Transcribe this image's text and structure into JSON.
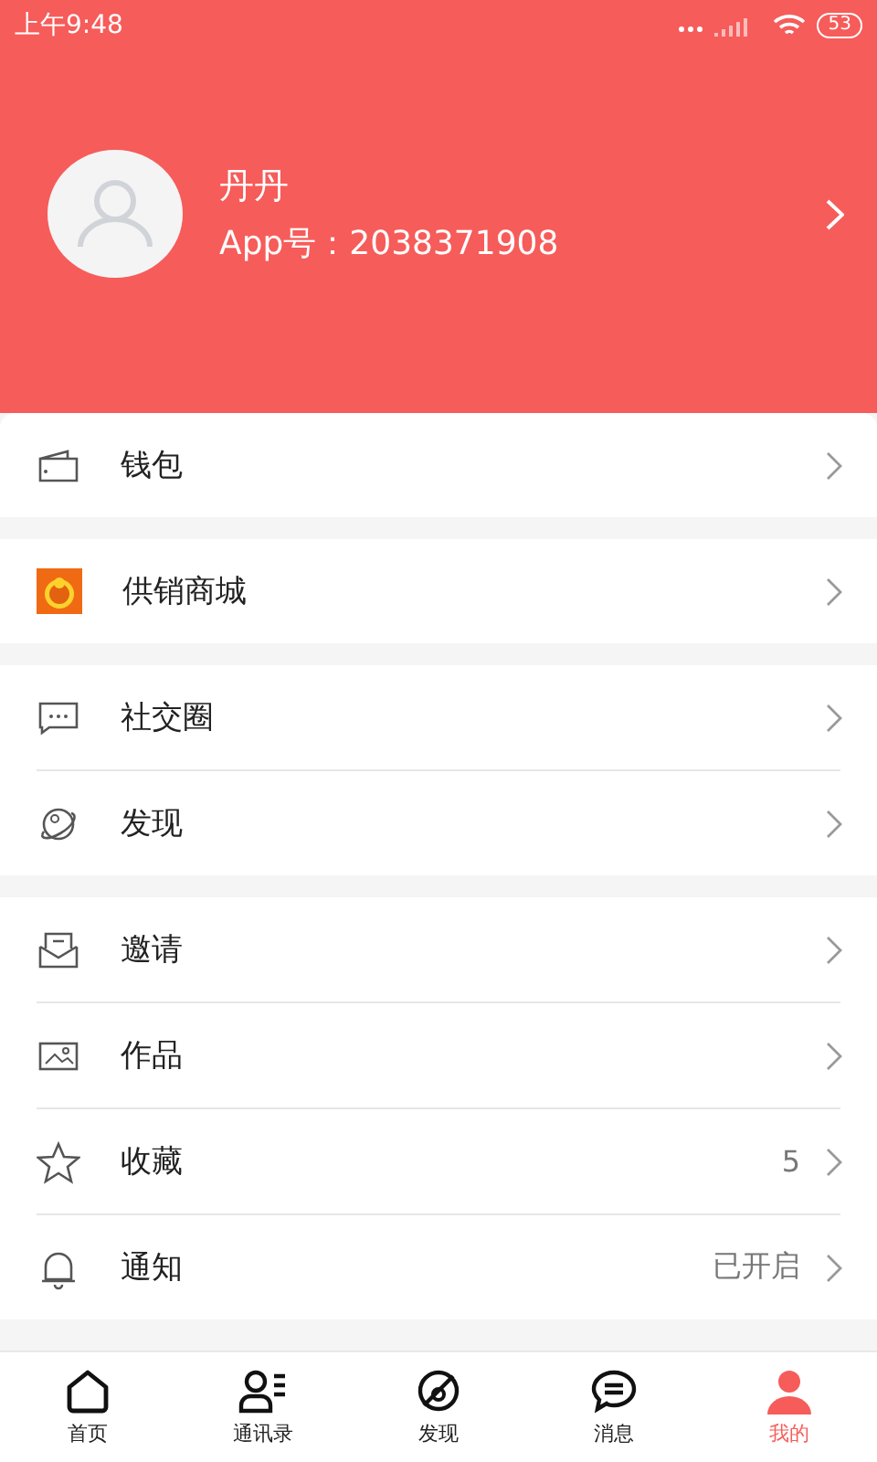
{
  "status_bar": {
    "time": "上午9:48",
    "battery": "53"
  },
  "profile": {
    "name": "丹丹",
    "app_id": "App号：2038371908"
  },
  "groups": [
    {
      "items": [
        {
          "kind": "wallet",
          "label": "钱包"
        }
      ]
    },
    {
      "items": [
        {
          "kind": "shop",
          "label": "供销商城"
        }
      ]
    },
    {
      "items": [
        {
          "kind": "chat",
          "label": "社交圈"
        },
        {
          "kind": "planet",
          "label": "发现"
        }
      ]
    },
    {
      "items": [
        {
          "kind": "mail",
          "label": "邀请"
        },
        {
          "kind": "image",
          "label": "作品"
        },
        {
          "kind": "star",
          "label": "收藏",
          "value": "5"
        },
        {
          "kind": "bell",
          "label": "通知",
          "value": "已开启"
        }
      ]
    }
  ],
  "tabs": [
    {
      "kind": "home",
      "label": "首页",
      "selected": false
    },
    {
      "kind": "contacts",
      "label": "通讯录",
      "selected": false
    },
    {
      "kind": "discover",
      "label": "发现",
      "selected": false
    },
    {
      "kind": "message",
      "label": "消息",
      "selected": false
    },
    {
      "kind": "person",
      "label": "我的",
      "selected": true
    }
  ]
}
